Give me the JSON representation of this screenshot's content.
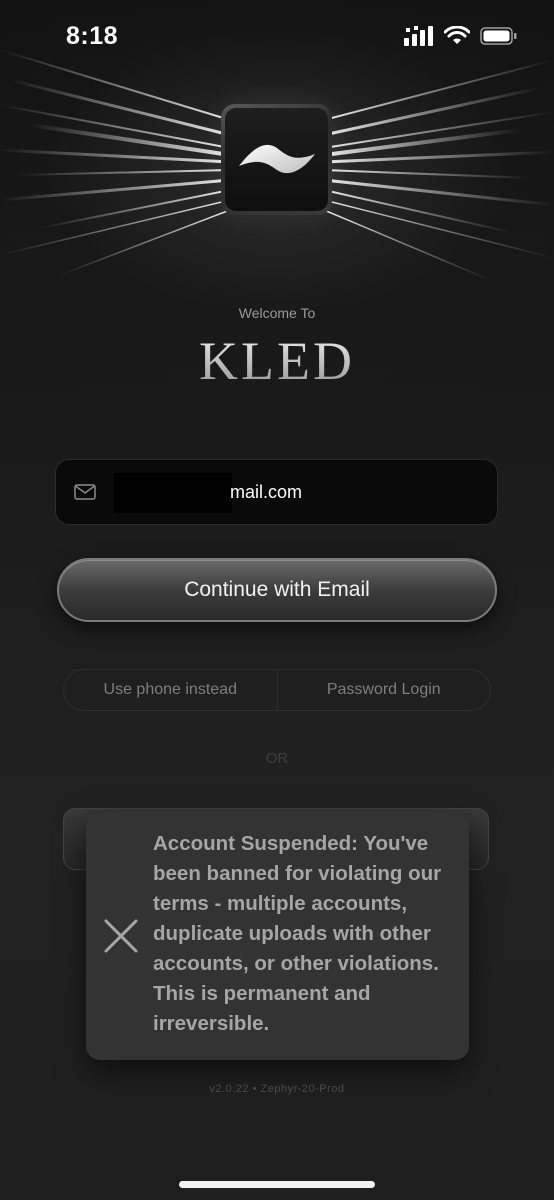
{
  "status_bar": {
    "time": "8:18"
  },
  "header": {
    "welcome": "Welcome To",
    "brand": "KLED"
  },
  "login": {
    "email_value": "mail.com",
    "continue_label": "Continue with Email",
    "phone_option": "Use phone instead",
    "password_option": "Password Login",
    "or_label": "OR"
  },
  "toast": {
    "message": "Account Suspended: You've been banned for violating our terms - multiple accounts, duplicate uploads with other accounts, or other violations. This is permanent and irreversible."
  },
  "footer": {
    "version": "v2.0.22 • Zephyr-20-Prod"
  },
  "icons": {
    "mail": "mail-icon",
    "close": "close-icon",
    "signal": "signal-icon",
    "wifi": "wifi-icon",
    "battery": "battery-icon"
  },
  "colors": {
    "background": "#1a1a1a",
    "toast_background": "#333333",
    "toast_text": "#a6a6a6"
  }
}
